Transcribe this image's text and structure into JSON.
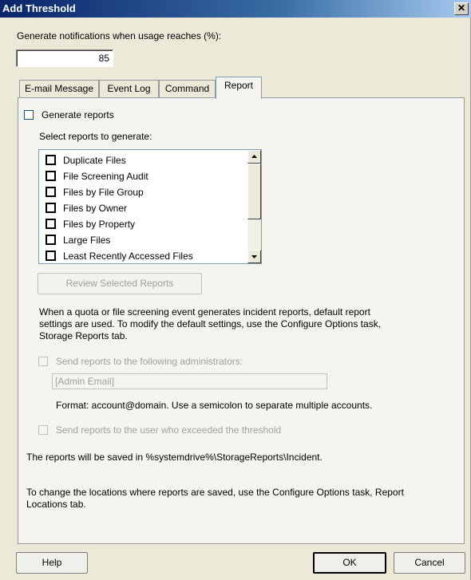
{
  "window": {
    "title": "Add Threshold",
    "close_glyph": "✕"
  },
  "threshold": {
    "label": "Generate notifications when usage reaches (%):",
    "value": "85"
  },
  "tabs": [
    {
      "label": "E-mail Message",
      "active": false
    },
    {
      "label": "Event Log",
      "active": false
    },
    {
      "label": "Command",
      "active": false
    },
    {
      "label": "Report",
      "active": true
    }
  ],
  "report": {
    "generate_label": "Generate reports",
    "select_label": "Select reports to generate:",
    "report_items": [
      "Duplicate Files",
      "File Screening Audit",
      "Files by File Group",
      "Files by Owner",
      "Files by Property",
      "Large Files",
      "Least Recently Accessed Files"
    ],
    "review_button": "Review Selected Reports",
    "info_lines": [
      "When a quota or file screening event generates incident reports, default report",
      "settings are used. To modify the default settings, use the Configure Options task,",
      "Storage Reports tab."
    ],
    "send_admins_label": "Send reports to the following administrators:",
    "admin_email_placeholder": "[Admin Email]",
    "format_text": "Format: account@domain. Use a semicolon to separate multiple accounts.",
    "send_user_label": "Send reports to the user who exceeded the threshold",
    "saved_text": "The reports will be saved in %systemdrive%\\StorageReports\\Incident.",
    "locations_lines": [
      "To change the locations where reports are saved, use the Configure Options task, Report",
      "Locations tab."
    ]
  },
  "buttons": {
    "help": "Help",
    "ok": "OK",
    "cancel": "Cancel"
  }
}
